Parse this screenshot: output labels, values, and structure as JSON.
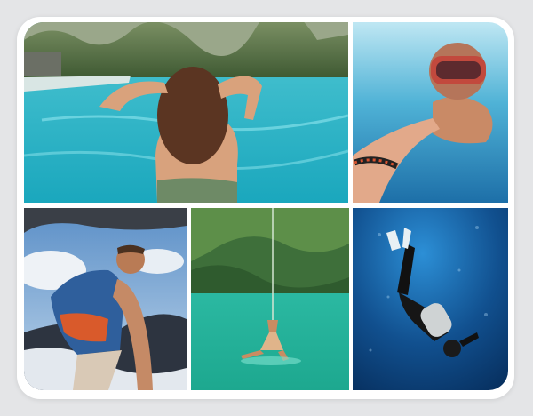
{
  "collage": {
    "background": "#e4e5e7",
    "frame_color": "#ffffff",
    "photos": [
      {
        "subject": "woman-in-pool-photo"
      },
      {
        "subject": "snorkeler-selfie-photo"
      },
      {
        "subject": "wakeboarder-photo"
      },
      {
        "subject": "rope-swing-lagoon-photo"
      },
      {
        "subject": "scuba-diver-photo"
      }
    ]
  }
}
